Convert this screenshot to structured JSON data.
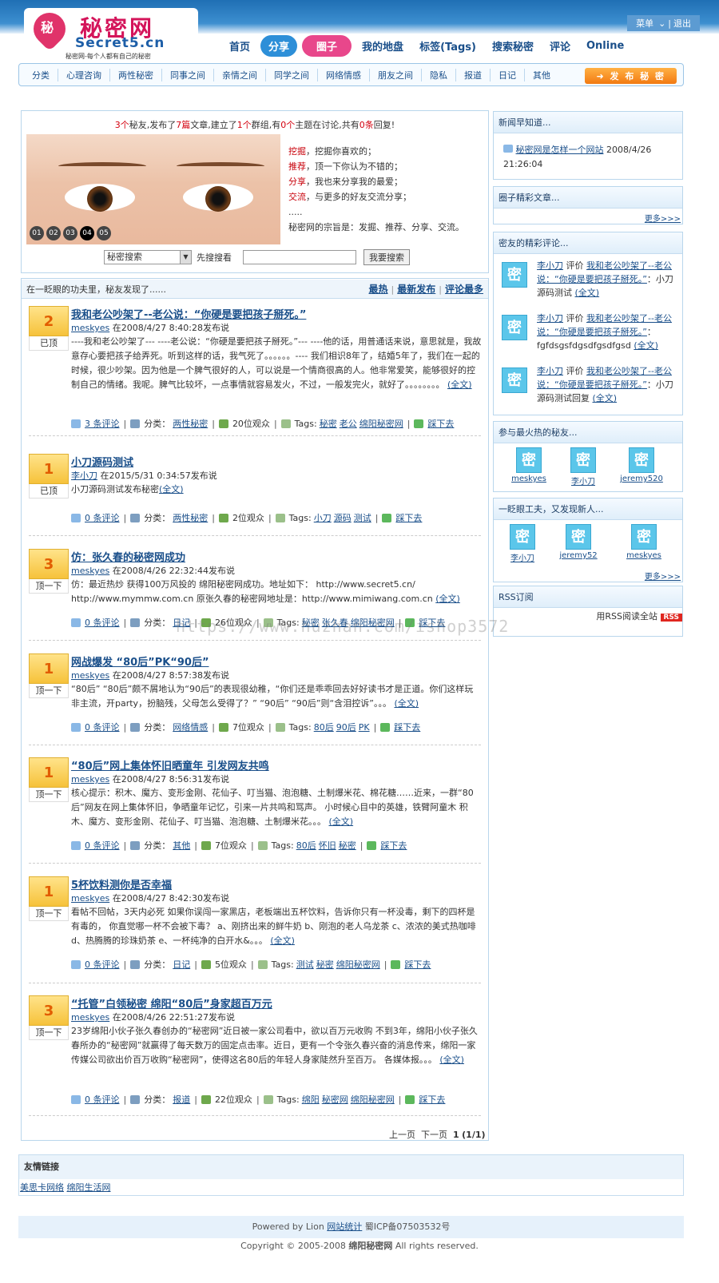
{
  "header": {
    "logo_glyph": "秘",
    "logo_title": "秘密网",
    "logo_domain": "Secret5.cn",
    "logo_slogan": "秘密网-每个人都有自己的秘密",
    "menu_label": "菜单",
    "logout_label": "退出"
  },
  "nav": [
    "首页",
    "分享",
    "圈子",
    "我的地盘",
    "标签(Tags)",
    "搜索秘密",
    "评论",
    "Online"
  ],
  "categories": [
    "分类",
    "心理咨询",
    "两性秘密",
    "同事之间",
    "亲情之间",
    "同学之间",
    "网络情感",
    "朋友之间",
    "隐私",
    "报道",
    "日记",
    "其他"
  ],
  "post_button": "发 布 秘 密",
  "stats": {
    "n1": "3个",
    "t1": "秘友,发布了",
    "n2": "7篇",
    "t2": "文章,建立了",
    "n3": "1个",
    "t3": "群组,有",
    "n4": "0个",
    "t4": "主题在讨论,共有",
    "n5": "0条",
    "t5": "回复!"
  },
  "slides": [
    "01",
    "02",
    "03",
    "04",
    "05"
  ],
  "intro": [
    {
      "k": "挖掘",
      "t": "，挖掘你喜欢的；"
    },
    {
      "k": "推荐",
      "t": "，顶一下你认为不错的；"
    },
    {
      "k": "分享",
      "t": "，我也来分享我的最爱；"
    },
    {
      "k": "交流",
      "t": "，与更多的好友交流分享；"
    }
  ],
  "intro_dots": ".....",
  "intro_purpose": "秘密网的宗旨是：发掘、推荐、分享、交流。",
  "search": {
    "select": "秘密搜索",
    "hint": "先搜搜看",
    "button": "我要搜索"
  },
  "feed": {
    "caption": "在一眨眼的功夫里，秘友发现了......",
    "sort": [
      "最热",
      "最新发布",
      "评论最多"
    ]
  },
  "posts": [
    {
      "votes": "2",
      "vote_label": "已顶",
      "title": "我和老公吵架了--老公说：“你硬是要把孩子掰死。”",
      "author": "meskyes",
      "date": "在2008/4/27 8:40:28发布说",
      "body": "----我和老公吵架了---  ----老公说：“你硬是要把孩子掰死。”---  ----他的话，用普通话来说，意思就是，我故意存心要把孩子给弄死。听到这样的话，我气死了。。。。。。---- 我们相识8年了，结婚5年了，我们在一起的时候，很少吵架。因为他是一个脾气很好的人，可以说是一个情商很高的人。他非常爱笑，能够很好的控制自己的情绪。我呢。脾气比较坏，一点事情就容易发火，不过，一般发完火，就好了。。。。。。。。",
      "more": "(全文)",
      "comments": "3 条评论",
      "category": "两性秘密",
      "views": "20位观众",
      "tags": [
        "秘密",
        "老公",
        "绵阳秘密网"
      ],
      "down": "踩下去"
    },
    {
      "votes": "1",
      "vote_label": "已顶",
      "title": "小刀源码测试",
      "author": "李小刀",
      "date": "在2015/5/31 0:34:57发布说",
      "body": "小刀源码测试发布秘密",
      "more": "(全文)",
      "comments": "0 条评论",
      "category": "两性秘密",
      "views": "2位观众",
      "tags": [
        "小刀",
        "源码",
        "测试"
      ],
      "down": "踩下去"
    },
    {
      "votes": "3",
      "vote_label": "顶一下",
      "title": "仿：张久春的秘密网成功",
      "author": "meskyes",
      "date": "在2008/4/26 22:32:44发布说",
      "body": "仿：最近热炒 获得100万风投的 绵阳秘密网成功。地址如下： http://www.secret5.cn/  http://www.mymmw.com.cn 原张久春的秘密网地址是：http://www.mimiwang.com.cn",
      "more": "(全文)",
      "comments": "0 条评论",
      "category": "日记",
      "views": "26位观众",
      "tags": [
        "秘密",
        "张久春",
        "绵阳秘密网"
      ],
      "down": "踩下去"
    },
    {
      "votes": "1",
      "vote_label": "顶一下",
      "title": "网战爆发 “80后”PK“90后”",
      "author": "meskyes",
      "date": "在2008/4/27 8:57:38发布说",
      "body": "“80后” “80后”颇不屑地认为“90后”的表现很幼稚，“你们还是乖乖回去好好读书才是正道。你们这样玩非主流，开party，扮脑残，父母怎么受得了？” “90后” “90后”则“含泪控诉”。。。",
      "more": "(全文)",
      "comments": "0 条评论",
      "category": "网络情感",
      "views": "7位观众",
      "tags": [
        "80后",
        "90后",
        "PK"
      ],
      "down": "踩下去"
    },
    {
      "votes": "1",
      "vote_label": "顶一下",
      "title": "“80后”网上集体怀旧晒童年 引发网友共鸣",
      "author": "meskyes",
      "date": "在2008/4/27 8:56:31发布说",
      "body": "核心提示：积木、魔方、变形金刚、花仙子、叮当猫、泡泡糖、土制爆米花、棉花糖……近来，一群“80后”网友在网上集体怀旧，争晒童年记忆，引来一片共鸣和骂声。 小时候心目中的英雄，铁臂阿童木 积木、魔方、变形金刚、花仙子、叮当猫、泡泡糖、土制爆米花。。。",
      "more": "(全文)",
      "comments": "0 条评论",
      "category": "其他",
      "views": "7位观众",
      "tags": [
        "80后",
        "怀旧",
        "秘密"
      ],
      "down": "踩下去"
    },
    {
      "votes": "1",
      "vote_label": "顶一下",
      "title": "5杯饮料测你是否幸福",
      "author": "meskyes",
      "date": "在2008/4/27 8:42:30发布说",
      "body": "看帖不回帖，3天内必死 如果你误闯一家黑店，老板端出五杯饮料，告诉你只有一杯没毒，剩下的四杯是有毒的， 你直觉哪一杯不会被下毒？ a、刚挤出来的鲜牛奶 b、刚泡的老人乌龙茶 c、浓浓的美式热咖啡 d、热腾腾的珍珠奶茶 e、一杯纯净的白开水&。。。",
      "more": "(全文)",
      "comments": "0 条评论",
      "category": "日记",
      "views": "5位观众",
      "tags": [
        "测试",
        "秘密",
        "绵阳秘密网"
      ],
      "down": "踩下去"
    },
    {
      "votes": "3",
      "vote_label": "顶一下",
      "title": "“托管”白领秘密 绵阳“80后”身家超百万元",
      "author": "meskyes",
      "date": "在2008/4/26 22:51:27发布说",
      "body": "23岁绵阳小伙子张久春创办的“秘密网”近日被一家公司看中，欲以百万元收购 不到3年，绵阳小伙子张久春所办的“秘密网”就赢得了每天数万的固定点击率。近日，更有一个令张久春兴奋的消息传来，绵阳一家传媒公司欲出价百万收购“秘密网”，使得这名80后的年轻人身家陡然升至百万。 各媒体报。。。",
      "more": "(全文)",
      "comments": "0 条评论",
      "category": "报道",
      "views": "22位观众",
      "tags": [
        "绵阳",
        "秘密网",
        "绵阳秘密网"
      ],
      "down": "踩下去"
    }
  ],
  "pager": {
    "prev": "上一页",
    "next": "下一页",
    "current": "1",
    "total": "(1/1)"
  },
  "sidebar": {
    "news": {
      "title": "新闻早知道...",
      "item": "秘密网是怎样一个网站",
      "time": "2008/4/26 21:26:04"
    },
    "circle": {
      "title": "圈子精彩文章...",
      "more": "更多>>>"
    },
    "reviews": {
      "title": "密友的精彩评论...",
      "items": [
        {
          "user": "李小刀",
          "verb": "评价",
          "post": "我和老公吵架了--老公说：“你硬是要把孩子掰死。”",
          "text": "小刀源码测试",
          "more": "(全文)"
        },
        {
          "user": "李小刀",
          "verb": "评价",
          "post": "我和老公吵架了--老公说：“你硬是要把孩子掰死。”",
          "text": "fgfdsgsfdgsdfgsdfgsd",
          "more": "(全文)"
        },
        {
          "user": "李小刀",
          "verb": "评价",
          "post": "我和老公吵架了--老公说：“你硬是要把孩子掰死。”",
          "text": "小刀源码测试回复",
          "more": "(全文)"
        }
      ]
    },
    "hot": {
      "title": "参与最火热的秘友...",
      "users": [
        "meskyes",
        "李小刀",
        "jeremy520"
      ]
    },
    "newbies": {
      "title": "一眨眼工夫，又发现新人...",
      "users": [
        "李小刀",
        "jeremy52",
        "meskyes"
      ],
      "more": "更多>>>"
    },
    "rss": {
      "title": "RSS订阅",
      "text": "用RSS阅读全站",
      "badge": "RSS"
    },
    "avatar_glyph": "密"
  },
  "friend_links": {
    "title": "友情链接",
    "items": [
      "美思卡网络",
      "绵阳生活网"
    ]
  },
  "footer": {
    "powered": "Powered by Lion",
    "stats": "网站统计",
    "icp": "蜀ICP备07503532号",
    "copyright": "Copyright © 2005-2008",
    "site": "绵阳秘密网",
    "rights": "All rights reserved."
  },
  "watermark": "https://www.huzhan.com/ishop3572"
}
